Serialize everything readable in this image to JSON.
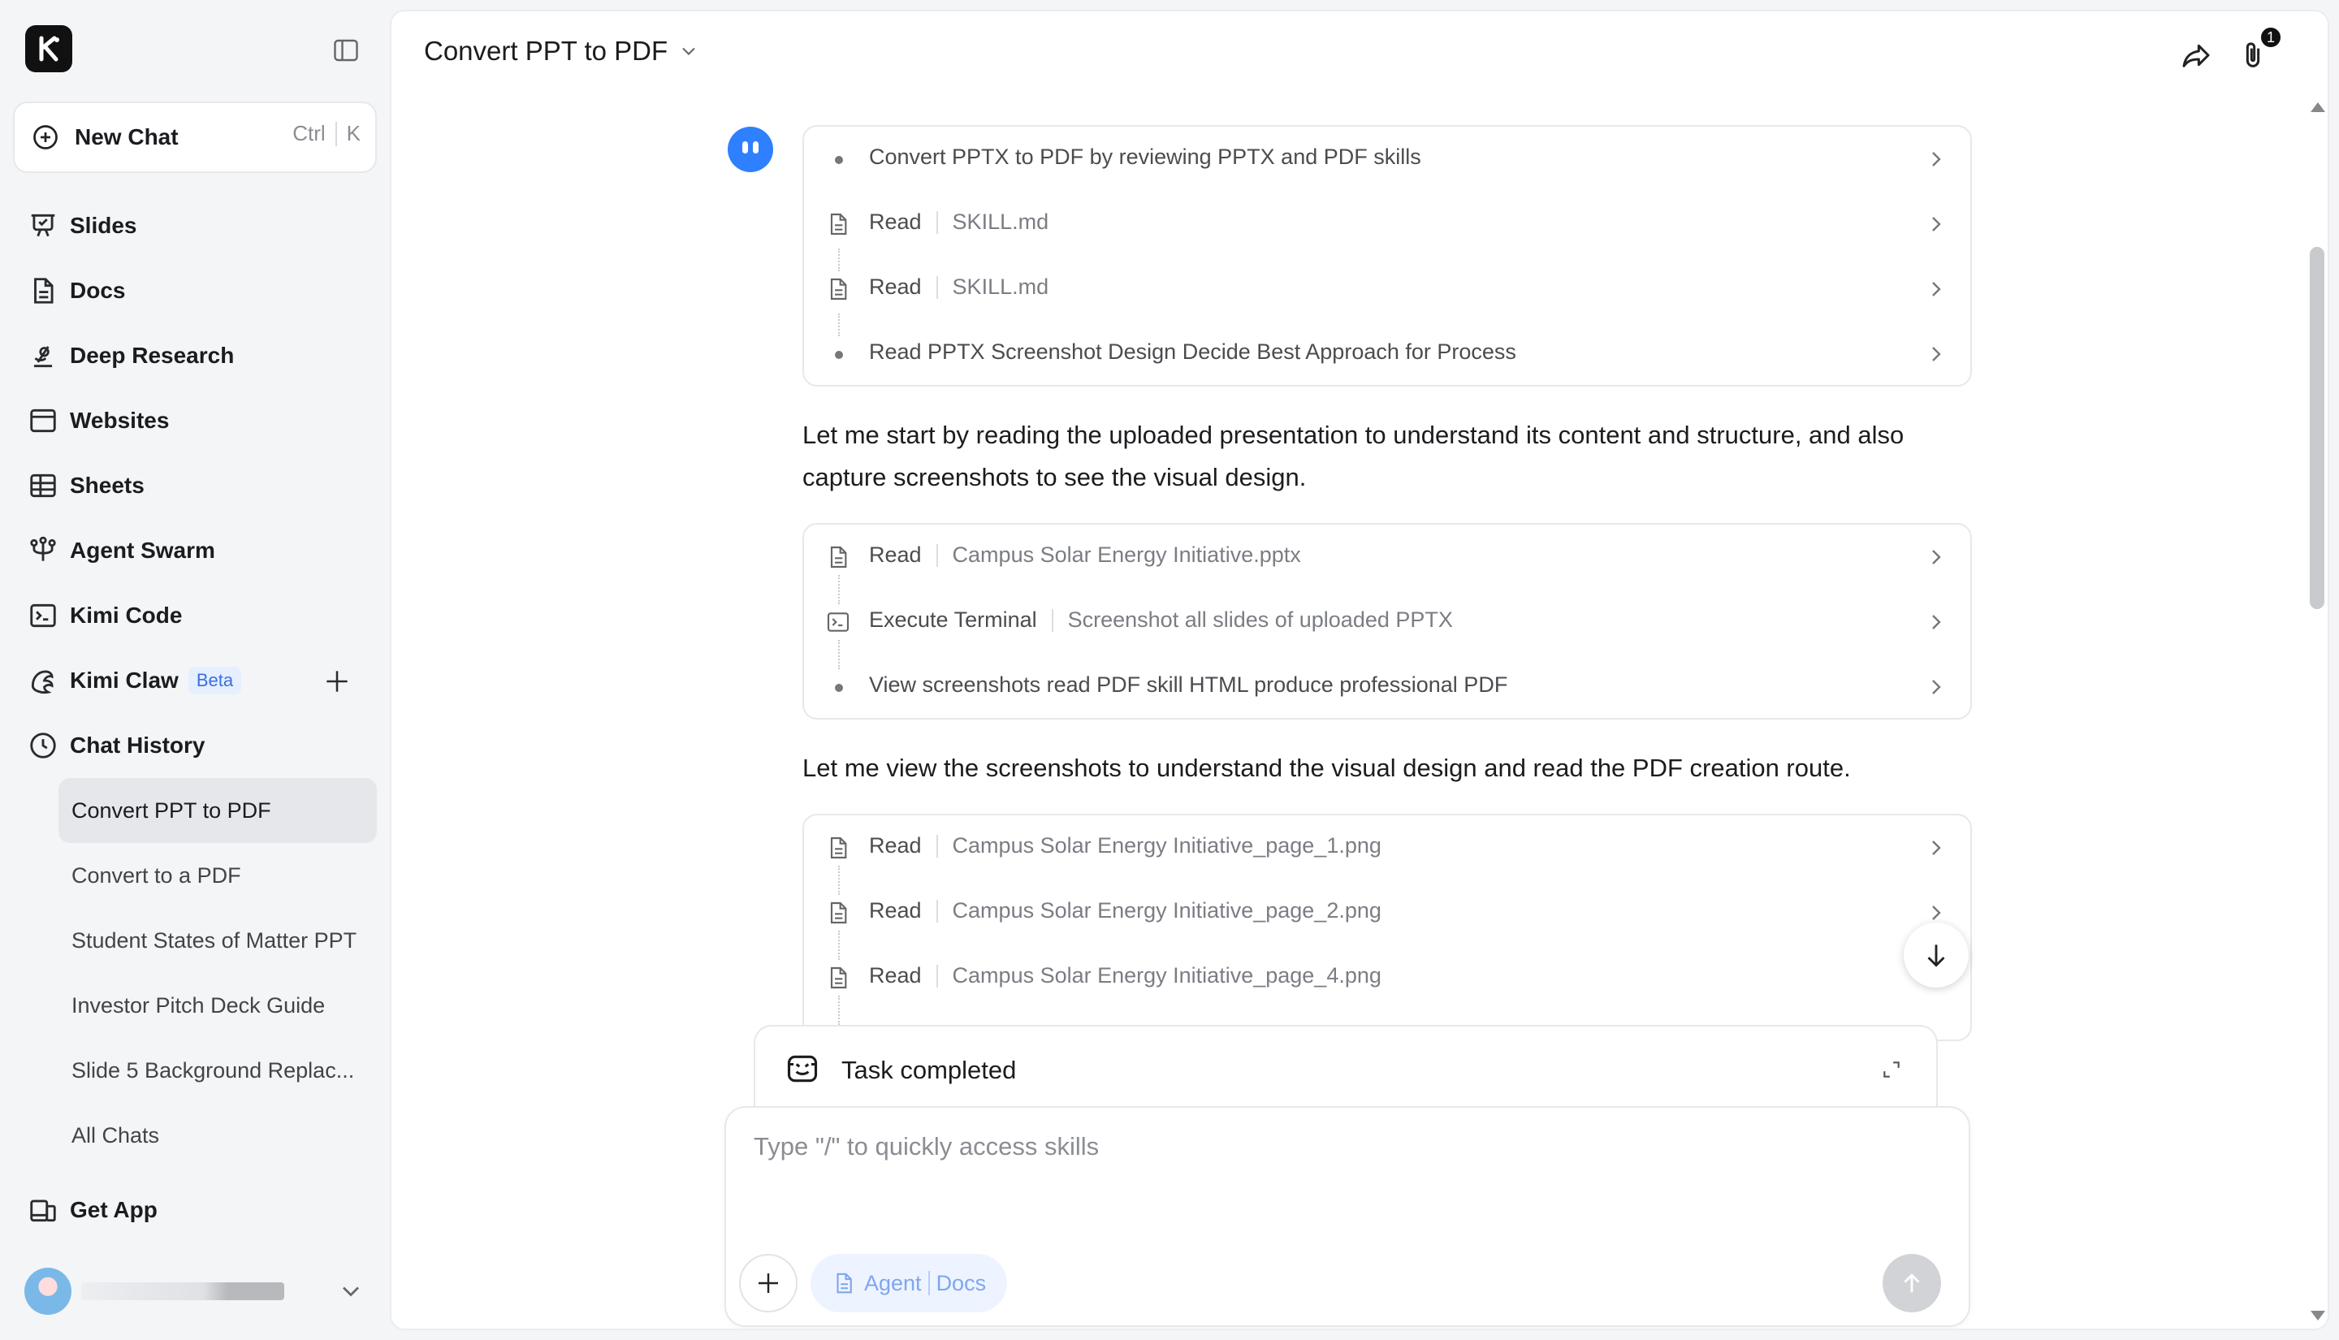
{
  "sidebar": {
    "new_chat": {
      "label": "New Chat",
      "shortcut_ctrl": "Ctrl",
      "shortcut_key": "K"
    },
    "nav": [
      {
        "label": "Slides",
        "icon": "slides-icon"
      },
      {
        "label": "Docs",
        "icon": "docs-icon"
      },
      {
        "label": "Deep Research",
        "icon": "deep-research-icon"
      },
      {
        "label": "Websites",
        "icon": "websites-icon"
      },
      {
        "label": "Sheets",
        "icon": "sheets-icon"
      },
      {
        "label": "Agent Swarm",
        "icon": "agent-swarm-icon"
      },
      {
        "label": "Kimi Code",
        "icon": "terminal-icon"
      },
      {
        "label": "Kimi Claw",
        "icon": "claw-icon",
        "badge": "Beta"
      },
      {
        "label": "Chat History",
        "icon": "clock-icon"
      }
    ],
    "history": [
      {
        "label": "Convert PPT to PDF",
        "active": true
      },
      {
        "label": "Convert to a PDF"
      },
      {
        "label": "Student States of Matter PPT"
      },
      {
        "label": "Investor Pitch Deck Guide"
      },
      {
        "label": "Slide 5 Background Replac..."
      },
      {
        "label": "All Chats"
      }
    ],
    "get_app": "Get App"
  },
  "header": {
    "title": "Convert PPT to PDF",
    "attachment_count": "1"
  },
  "steps_group_1": [
    {
      "type": "dot",
      "action": "Convert PPTX to PDF by reviewing PPTX and PDF skills",
      "detail": ""
    },
    {
      "type": "file",
      "action": "Read",
      "detail": "SKILL.md"
    },
    {
      "type": "file",
      "action": "Read",
      "detail": "SKILL.md"
    },
    {
      "type": "dot",
      "action": "Read PPTX Screenshot Design Decide Best Approach for Process",
      "detail": ""
    }
  ],
  "message_1": "Let me start by reading the uploaded presentation to understand its content and structure, and also capture screenshots to see the visual design.",
  "steps_group_2": [
    {
      "type": "file",
      "action": "Read",
      "detail": "Campus Solar Energy Initiative.pptx"
    },
    {
      "type": "terminal",
      "action": "Execute Terminal",
      "detail": "Screenshot all slides of uploaded PPTX"
    },
    {
      "type": "dot",
      "action": "View screenshots read PDF skill HTML produce professional PDF",
      "detail": ""
    }
  ],
  "message_2": "Let me view the screenshots to understand the visual design and read the PDF creation route.",
  "steps_group_3": [
    {
      "type": "file",
      "action": "Read",
      "detail": "Campus Solar Energy Initiative_page_1.png"
    },
    {
      "type": "file",
      "action": "Read",
      "detail": "Campus Solar Energy Initiative_page_2.png"
    },
    {
      "type": "file",
      "action": "Read",
      "detail": "Campus Solar Energy Initiative_page_4.png"
    }
  ],
  "task_status": "Task completed",
  "composer": {
    "placeholder": "Type \"/\" to quickly access skills",
    "mode_agent": "Agent",
    "mode_docs": "Docs"
  },
  "colors": {
    "accent": "#2f80ff",
    "chip_bg": "#eef4ff",
    "chip_text": "#7fa6ee",
    "active_history": "#e6e7ea"
  }
}
